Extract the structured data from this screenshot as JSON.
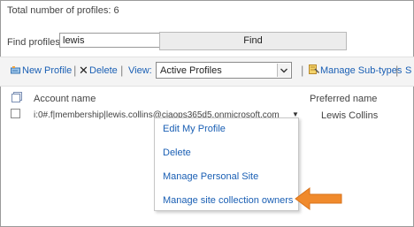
{
  "total_profiles_text": "Total number of profiles: 6",
  "search": {
    "label": "Find profiles",
    "value": "lewis",
    "button_label": "Find"
  },
  "toolbar": {
    "new_profile": "New Profile",
    "delete": "Delete",
    "view_label": "View:",
    "view_selected": "Active Profiles",
    "manage_subtypes": "Manage Sub-types",
    "overflow_text": "S"
  },
  "table": {
    "headers": {
      "account": "Account name",
      "preferred": "Preferred name"
    },
    "rows": [
      {
        "account": "i:0#.f|membership|lewis.collins@ciaops365d5.onmicrosoft.com",
        "preferred": "Lewis Collins"
      }
    ]
  },
  "context_menu": {
    "items": [
      "Edit My Profile",
      "Delete",
      "Manage Personal Site",
      "Manage site collection owners"
    ]
  },
  "colors": {
    "link": "#1a5fb4",
    "callout_arrow": "#f08a2c"
  },
  "icons": {
    "new_profile": "new-profile-icon",
    "delete": "delete-x-icon",
    "manage_subtypes": "manage-subtypes-icon",
    "header": "select-all-icon",
    "menu_caret": "caret-down-icon",
    "callout": "orange-arrow-icon"
  }
}
